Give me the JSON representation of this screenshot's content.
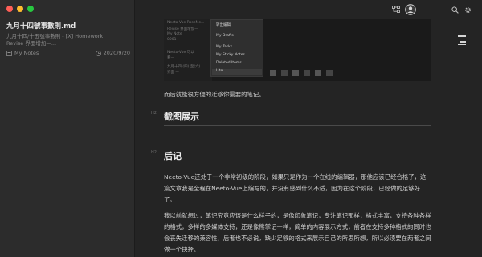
{
  "window": {
    "traffic": [
      "#ff5f57",
      "#febc2e",
      "#28c840"
    ]
  },
  "sidebar": {
    "note": {
      "title": "九月十四號事數則.md",
      "excerpt_lines": [
        "九月十四/十五號事數則 - [X] Homework",
        "Revise 界面增加—..."
      ],
      "notebook": "My Notes",
      "date": "2020/9/20"
    }
  },
  "toolbar": {
    "icons": [
      "tree-icon",
      "avatar-icon",
      "search-icon",
      "gear-icon"
    ]
  },
  "screenshot": {
    "left_lines": [
      "Neeto-Vue RoseMe...",
      "Revise 界面增加—",
      "My Note",
      "0001",
      "Neeto-Vue 可以",
      "看—",
      "九月十四 (四) 至(六)",
      "界面 —"
    ],
    "menu_items": [
      "转出编辑",
      "My Drafts",
      "My Tasks",
      "My Sticky Notes",
      "Deleted Items",
      "Lite"
    ],
    "menu_selected": "Lite"
  },
  "main": {
    "para1": "而后就能很方便的迁移你需要的笔记。",
    "h_screenshot": "截图展示",
    "h_afterword": "后记",
    "para2": "Neeto-Vue还处于一个非常初级的阶段，如果只是作为一个在线的编辑器，那他应该已经合格了，这篇文章我是全程在Neeto-Vue上编写的，并没有感到什么不适，因为在这个阶段，已经做的足够好了。",
    "para3": "我以前就想过，笔记究竟应该是什么样子的，是像印象笔记，专注笔记那样，格式丰富，支持各种各样的格式，多样的多媒体支持，还是像熊掌记一样，简单的内容展示方式，前者在支持多种格式的同时也会丧失迁移的兼容性，后者也不必说，缺少足够的格式来展示自己的所思所想，所以必须要在两者之间做一个抉择。",
    "hmark": "H2"
  }
}
